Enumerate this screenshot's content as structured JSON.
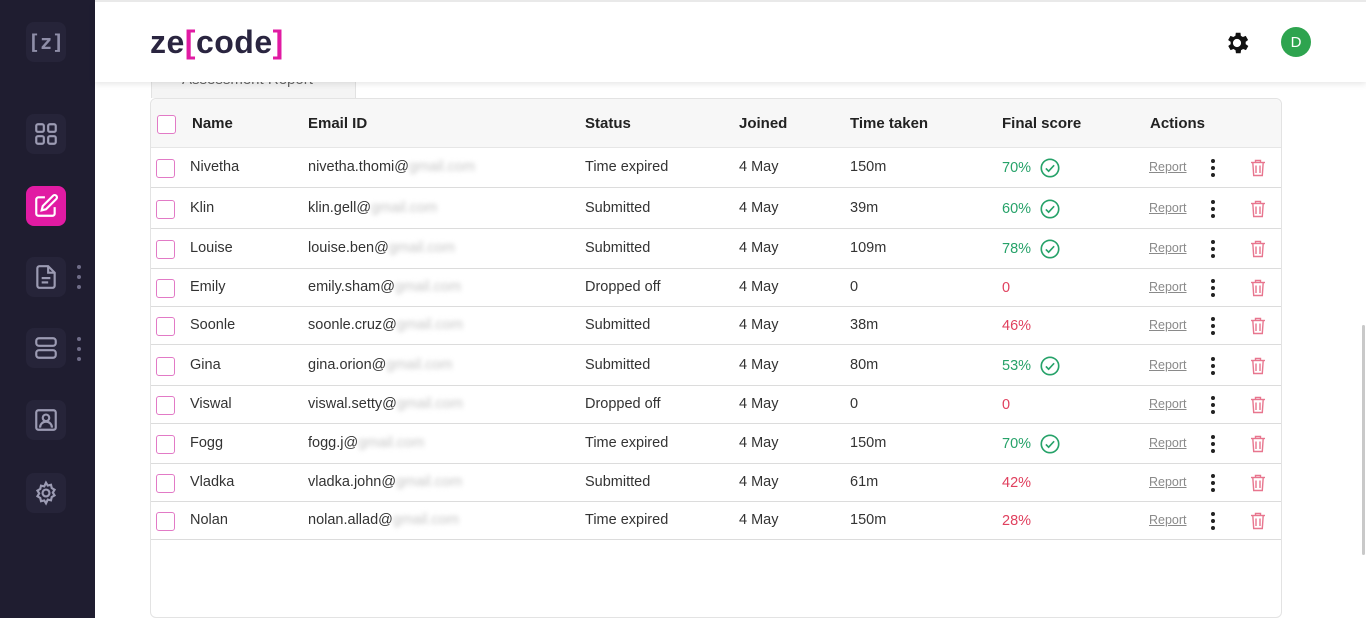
{
  "sidebar": {
    "logo_text": "[z]",
    "icons": [
      "dashboard-icon",
      "edit-icon",
      "document-icon",
      "server-icon",
      "id-card-icon",
      "settings-icon"
    ],
    "active": "edit-icon",
    "accent": "#e11ba3"
  },
  "header": {
    "logo_prefix": "ze",
    "logo_bracket_open": "[",
    "logo_word": "code",
    "logo_bracket_close": "]",
    "avatar_initial": "D",
    "avatar_color": "#2ea44f"
  },
  "tab": {
    "label": "Assessment Report"
  },
  "table": {
    "columns": [
      "Name",
      "Email ID",
      "Status",
      "Joined",
      "Time taken",
      "Final score",
      "Actions"
    ],
    "action_label": "Report",
    "rows": [
      {
        "name": "Nivetha",
        "email_user": "nivetha.thomi@",
        "email_domain": "gmail.com",
        "status": "Time expired",
        "joined": "4 May",
        "time": "150m",
        "score": "70%",
        "passed": true
      },
      {
        "name": "Klin",
        "email_user": "klin.gell@",
        "email_domain": "gmail.com",
        "status": "Submitted",
        "joined": "4 May",
        "time": "39m",
        "score": "60%",
        "passed": true
      },
      {
        "name": "Louise",
        "email_user": "louise.ben@",
        "email_domain": "gmail.com",
        "status": "Submitted",
        "joined": "4 May",
        "time": "109m",
        "score": "78%",
        "passed": true
      },
      {
        "name": "Emily",
        "email_user": "emily.sham@",
        "email_domain": "gmail.com",
        "status": "Dropped off",
        "joined": "4 May",
        "time": "0",
        "score": "0",
        "passed": false
      },
      {
        "name": "Soonle",
        "email_user": "soonle.cruz@",
        "email_domain": "gmail.com",
        "status": "Submitted",
        "joined": "4 May",
        "time": "38m",
        "score": "46%",
        "passed": false
      },
      {
        "name": "Gina",
        "email_user": "gina.orion@",
        "email_domain": "gmail.com",
        "status": "Submitted",
        "joined": "4 May",
        "time": "80m",
        "score": "53%",
        "passed": true
      },
      {
        "name": "Viswal",
        "email_user": "viswal.setty@",
        "email_domain": "gmail.com",
        "status": "Dropped off",
        "joined": "4 May",
        "time": "0",
        "score": "0",
        "passed": false
      },
      {
        "name": "Fogg",
        "email_user": "fogg.j@",
        "email_domain": "gmail.com",
        "status": "Time expired",
        "joined": "4 May",
        "time": "150m",
        "score": "70%",
        "passed": true
      },
      {
        "name": "Vladka",
        "email_user": "vladka.john@",
        "email_domain": "gmail.com",
        "status": "Submitted",
        "joined": "4 May",
        "time": "61m",
        "score": "42%",
        "passed": false
      },
      {
        "name": "Nolan",
        "email_user": "nolan.allad@",
        "email_domain": "gmail.com",
        "status": "Time expired",
        "joined": "4 May",
        "time": "150m",
        "score": "28%",
        "passed": false
      }
    ]
  },
  "colors": {
    "pass": "#26a269",
    "fail": "#e0405e",
    "checkbox": "#e27ac6",
    "trash": "#e8758e"
  }
}
